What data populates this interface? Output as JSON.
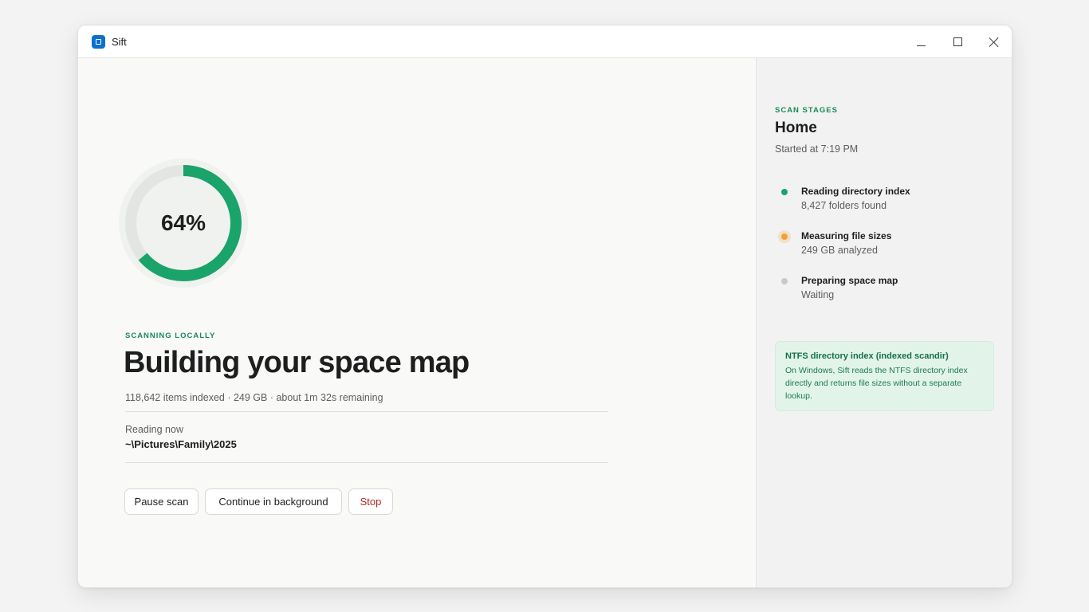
{
  "window": {
    "title": "Sift",
    "icons": {
      "app": "app-icon",
      "minimize": "minimize-icon",
      "maximize": "maximize-icon",
      "close": "close-icon"
    }
  },
  "scan": {
    "progress_percent": 64,
    "progress_label": "64%",
    "eyebrow": "SCANNING LOCALLY",
    "headline": "Building your space map",
    "stats": "118,642 items indexed · 249 GB · about 1m 32s remaining",
    "reading_label": "Reading now",
    "reading_path": "~\\Pictures\\Family\\2025",
    "colors": {
      "progress": "#1aa36a",
      "track": "#e3e5e2"
    }
  },
  "actions": {
    "pause": "Pause scan",
    "background": "Continue in background",
    "stop": "Stop"
  },
  "sidebar": {
    "eyebrow": "SCAN STAGES",
    "title": "Home",
    "started": "Started at 7:19 PM",
    "stages": [
      {
        "name": "Reading directory index",
        "detail": "8,427 folders found",
        "status": "done"
      },
      {
        "name": "Measuring file sizes",
        "detail": "249 GB analyzed",
        "status": "active"
      },
      {
        "name": "Preparing space map",
        "detail": "Waiting",
        "status": "waiting"
      }
    ],
    "status_colors": {
      "done": "#1aa36a",
      "active": "#f0a13a",
      "waiting": "#c9cac8"
    },
    "info": {
      "title": "NTFS directory index (indexed scandir)",
      "body": "On Windows, Sift reads the NTFS directory index directly and returns file sizes without a separate lookup."
    }
  }
}
